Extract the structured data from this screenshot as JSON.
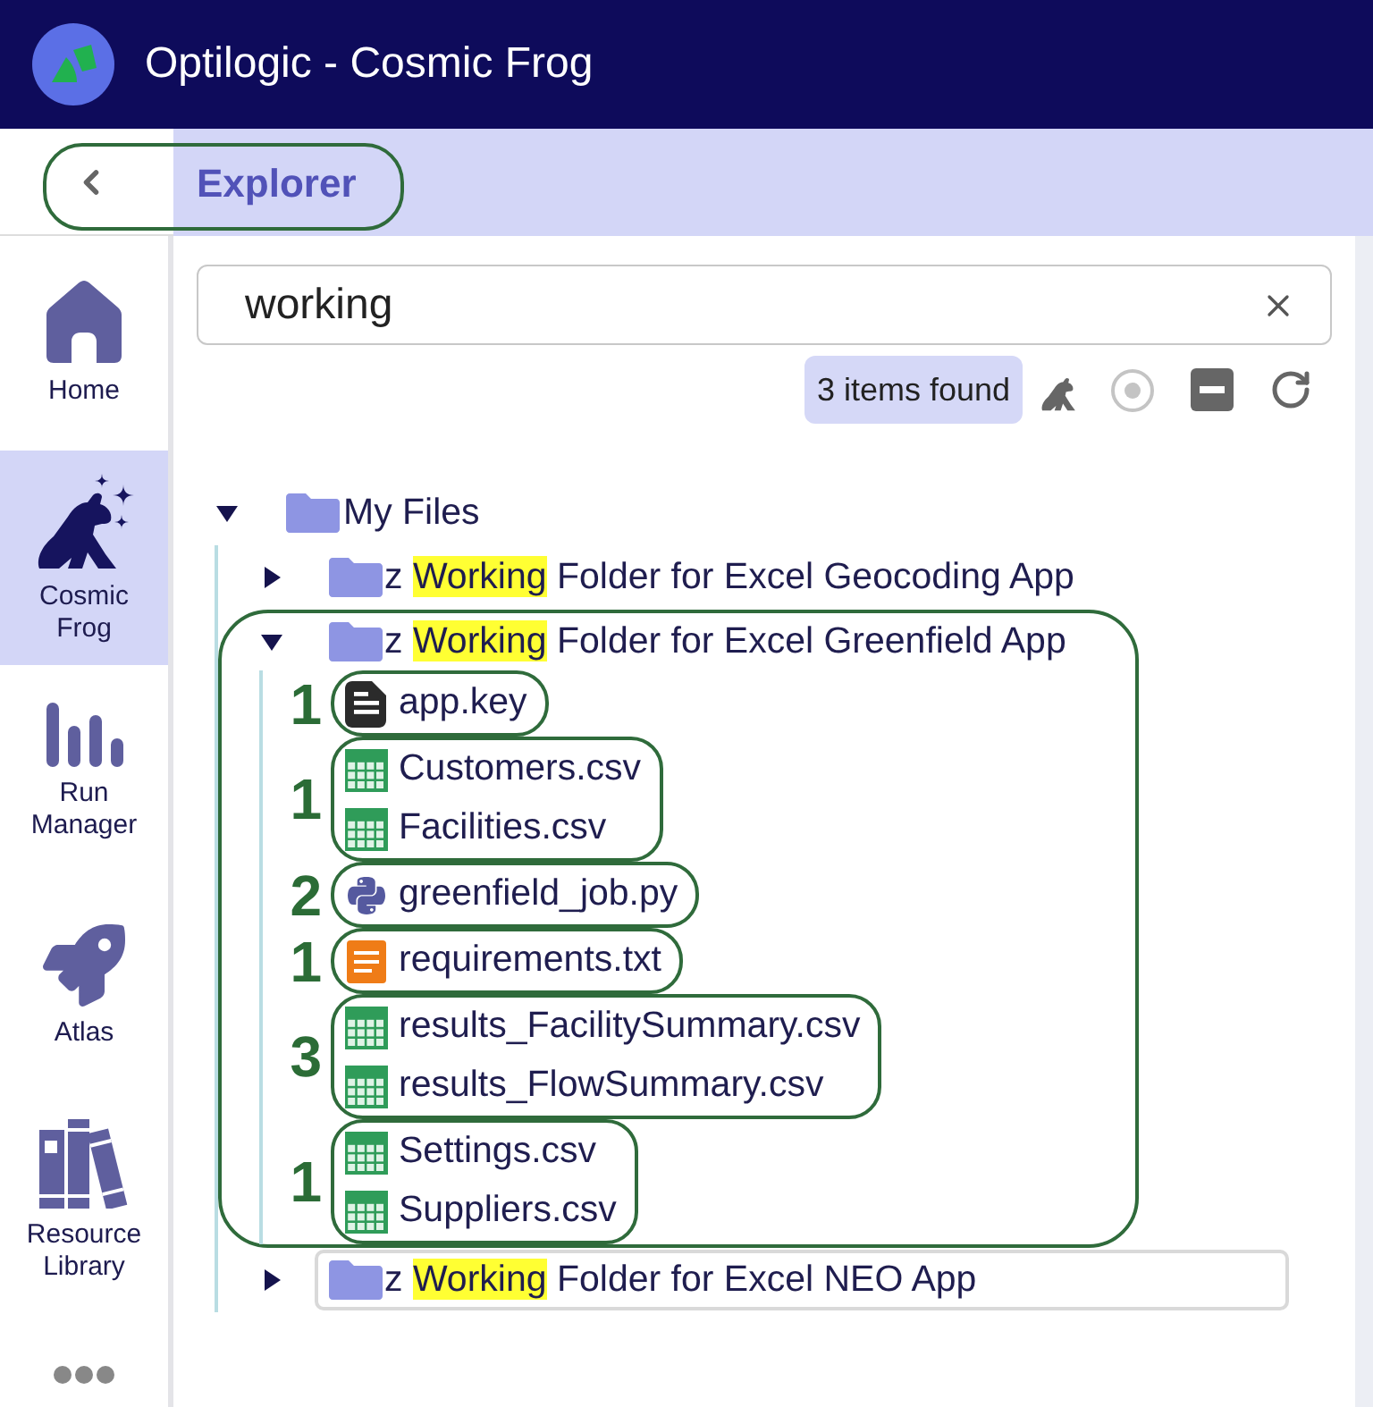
{
  "app_bar": {
    "title": "Optilogic - Cosmic Frog"
  },
  "sidebar": {
    "items": [
      {
        "label": "Home",
        "kind": "home",
        "selected": false
      },
      {
        "label": "Cosmic Frog",
        "kind": "frog",
        "selected": true
      },
      {
        "label": "Run Manager",
        "kind": "runs",
        "selected": false
      },
      {
        "label": "Atlas",
        "kind": "rocket",
        "selected": false
      },
      {
        "label": "Resource Library",
        "kind": "library",
        "selected": false
      }
    ]
  },
  "explorer": {
    "title": "Explorer",
    "title_annotated": true,
    "search": {
      "value": "working"
    },
    "result_count": "3 items found",
    "tree": {
      "label": "My Files",
      "expanded": true,
      "children": [
        {
          "name": {
            "before": "z ",
            "match": "Working",
            "after": " Folder for Excel Geocoding App"
          },
          "expanded": false,
          "annotated": false,
          "focused": false
        },
        {
          "name": {
            "before": "z ",
            "match": "Working",
            "after": " Folder for Excel Greenfield App"
          },
          "expanded": true,
          "annotated": true,
          "focused": false,
          "groups": [
            {
              "annotation": "1",
              "children": [
                {
                  "kind": "key",
                  "name": "app.key"
                }
              ]
            },
            {
              "annotation": "1",
              "children": [
                {
                  "kind": "csv",
                  "name": "Customers.csv"
                },
                {
                  "kind": "csv",
                  "name": "Facilities.csv"
                }
              ]
            },
            {
              "annotation": "2",
              "children": [
                {
                  "kind": "python",
                  "name": "greenfield_job.py"
                }
              ]
            },
            {
              "annotation": "1",
              "children": [
                {
                  "kind": "text",
                  "name": "requirements.txt"
                }
              ]
            },
            {
              "annotation": "3",
              "children": [
                {
                  "kind": "csv",
                  "name": "results_FacilitySummary.csv"
                },
                {
                  "kind": "csv",
                  "name": "results_FlowSummary.csv"
                }
              ]
            },
            {
              "annotation": "1",
              "children": [
                {
                  "kind": "csv",
                  "name": "Settings.csv"
                },
                {
                  "kind": "csv",
                  "name": "Suppliers.csv"
                }
              ]
            }
          ]
        },
        {
          "name": {
            "before": "z ",
            "match": "Working",
            "after": " Folder for Excel NEO App"
          },
          "expanded": false,
          "annotated": false,
          "focused": true
        }
      ]
    }
  }
}
